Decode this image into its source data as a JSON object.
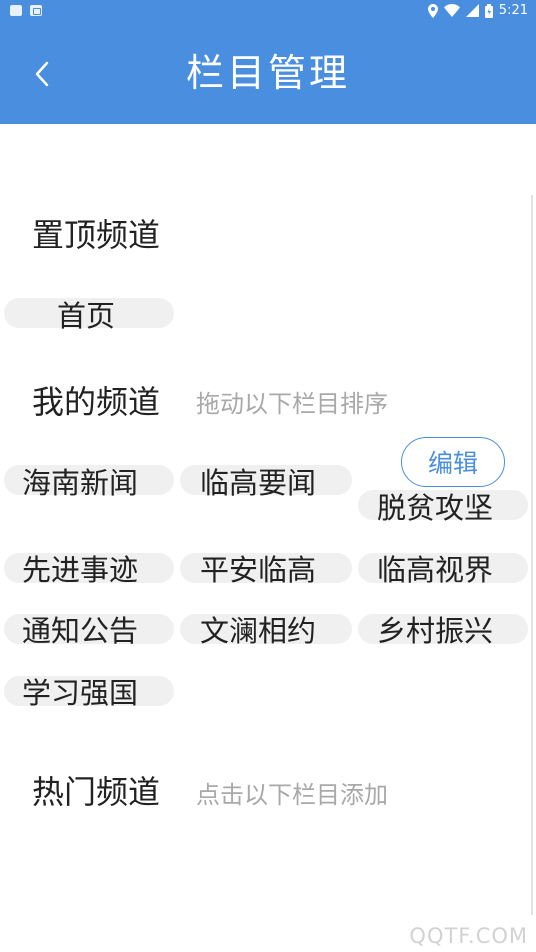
{
  "status_bar": {
    "time": "5:21",
    "left_icons": [
      "notification-icon",
      "app-notification-icon"
    ],
    "right_icons": [
      "location-icon",
      "wifi-icon",
      "cellular-icon",
      "battery-icon"
    ]
  },
  "header": {
    "title": "栏目管理",
    "back_icon": "chevron-left-icon",
    "background": "#4a8fdf"
  },
  "pinned": {
    "title": "置顶频道",
    "items": [
      "首页"
    ]
  },
  "my_channels": {
    "title": "我的频道",
    "hint": "拖动以下栏目排序",
    "edit_label": "编辑",
    "items": [
      "海南新闻",
      "临高要闻",
      "脱贫攻坚",
      "先进事迹",
      "平安临高",
      "临高视界",
      "通知公告",
      "文澜相约",
      "乡村振兴",
      "学习强国"
    ]
  },
  "hot_channels": {
    "title": "热门频道",
    "hint": "点击以下栏目添加"
  },
  "watermark": "QQTF.COM",
  "colors": {
    "accent": "#4a8fdf",
    "chip_bg": "#f0f0f0",
    "hint": "#a9a9a9"
  }
}
